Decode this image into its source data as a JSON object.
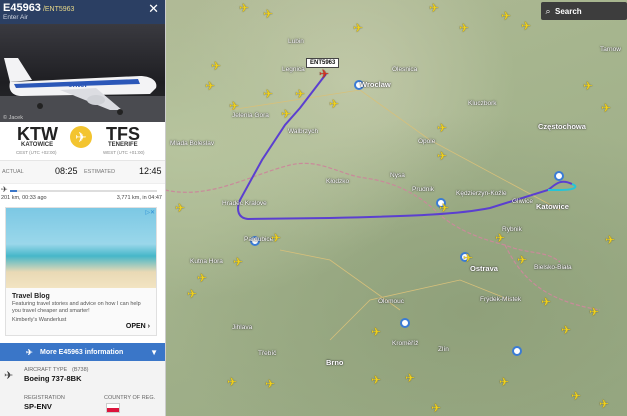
{
  "panel": {
    "callsign": "E45963",
    "flight_code": "/ENT5963",
    "airline": "Enter Air",
    "photo_credit": "© Jacek",
    "origin": {
      "iata": "KTW",
      "city": "KATOWICE",
      "tz": "CEST (UTC +02:00)"
    },
    "destination": {
      "iata": "TFS",
      "city": "TENERIFE",
      "tz": "WEST (UTC +01:00)"
    },
    "actual_label": "ACTUAL",
    "actual_time": "08:25",
    "estimated_label": "ESTIMATED",
    "estimated_time": "12:45",
    "progress": 0.05,
    "distance_flown": "201 km, 00:33 ago",
    "distance_remaining": "3,771 km, in 04:47",
    "ad": {
      "title": "Travel Blog",
      "description": "Featuring travel stories and advice on how I can help you travel cheaper and smarter!",
      "sponsor": "Kimberly's Wanderlust",
      "cta": "OPEN"
    },
    "more_label": "More E45963 information",
    "aircraft_type_label": "AIRCRAFT TYPE",
    "aircraft_type_code": "(B738)",
    "aircraft_type": "Boeing 737-8BK",
    "registration_label": "REGISTRATION",
    "registration": "SP-ENV",
    "country_label": "COUNTRY OF REG."
  },
  "map": {
    "search_label": "Search",
    "callout": "ENT5963",
    "cities": [
      "Lubin",
      "Legnica",
      "Wroclaw",
      "Olesnica",
      "Opole",
      "Kluczbork",
      "Częstochowa",
      "Walbrzych",
      "Jelenia Gora",
      "Kłodzko",
      "Nysa",
      "Prudnik",
      "Kędzierzyn-Koźle",
      "Gliwice",
      "Katowice",
      "Rybnik",
      "Ostrava",
      "Bielsko-Biała",
      "Hradec Kralove",
      "Pardubice",
      "Kutna Hora",
      "Olomouc",
      "Frýdek-Místek",
      "Brno",
      "Kroměříž",
      "Zlín",
      "Jihlava",
      "Mlada Boleslav",
      "Třebíč",
      "Tarnow"
    ]
  }
}
